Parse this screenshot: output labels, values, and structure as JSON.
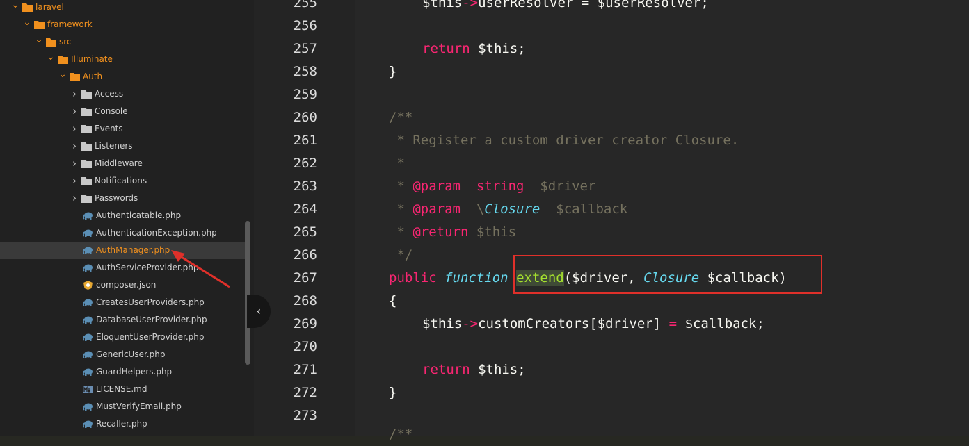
{
  "sidebar": {
    "tree": [
      {
        "label": "laravel",
        "kind": "folder",
        "open": true
      },
      {
        "label": "framework",
        "kind": "folder",
        "open": true
      },
      {
        "label": "src",
        "kind": "folder",
        "open": true
      },
      {
        "label": "Illuminate",
        "kind": "folder",
        "open": true
      },
      {
        "label": "Auth",
        "kind": "folder",
        "open": true
      },
      {
        "label": "Access",
        "kind": "folder",
        "open": false
      },
      {
        "label": "Console",
        "kind": "folder",
        "open": false
      },
      {
        "label": "Events",
        "kind": "folder",
        "open": false
      },
      {
        "label": "Listeners",
        "kind": "folder",
        "open": false
      },
      {
        "label": "Middleware",
        "kind": "folder",
        "open": false
      },
      {
        "label": "Notifications",
        "kind": "folder",
        "open": false
      },
      {
        "label": "Passwords",
        "kind": "folder",
        "open": false
      },
      {
        "label": "Authenticatable.php",
        "kind": "php"
      },
      {
        "label": "AuthenticationException.php",
        "kind": "php"
      },
      {
        "label": "AuthManager.php",
        "kind": "php",
        "selected": true
      },
      {
        "label": "AuthServiceProvider.php",
        "kind": "php"
      },
      {
        "label": "composer.json",
        "kind": "json"
      },
      {
        "label": "CreatesUserProviders.php",
        "kind": "php"
      },
      {
        "label": "DatabaseUserProvider.php",
        "kind": "php"
      },
      {
        "label": "EloquentUserProvider.php",
        "kind": "php"
      },
      {
        "label": "GenericUser.php",
        "kind": "php"
      },
      {
        "label": "GuardHelpers.php",
        "kind": "php"
      },
      {
        "label": "LICENSE.md",
        "kind": "md"
      },
      {
        "label": "MustVerifyEmail.php",
        "kind": "php"
      },
      {
        "label": "Recaller.php",
        "kind": "php"
      }
    ]
  },
  "editor": {
    "line_numbers": [
      "255",
      "256",
      "257",
      "258",
      "259",
      "260",
      "261",
      "262",
      "263",
      "264",
      "265",
      "266",
      "267",
      "268",
      "269",
      "270",
      "271",
      "272",
      "273"
    ],
    "code": {
      "l255_this": "$this",
      "l255_arrow": "->",
      "l255_rest": "userResolver = $userResolver;",
      "l257_kw": "return",
      "l257_rest": " $this;",
      "l258": "}",
      "l260": "/**",
      "l261": " * Register a custom driver creator Closure.",
      "l262": " *",
      "l263_star": " * ",
      "l263_tag": "@param",
      "l263_type": "  string",
      "l263_var": "  $driver",
      "l264_star": " * ",
      "l264_tag": "@param",
      "l264_slash": "  \\",
      "l264_type": "Closure",
      "l264_var": "  $callback",
      "l265_star": " * ",
      "l265_tag": "@return",
      "l265_var": " $this",
      "l266": " */",
      "l267_kw": "public",
      "l267_fn": "function",
      "l267_name": "extend",
      "l267_open": "($driver, ",
      "l267_type": "Closure",
      "l267_close": " $callback)",
      "l268": "{",
      "l269_this": "$this",
      "l269_arrow": "->",
      "l269_mid": "customCreators[$driver] ",
      "l269_eq": "=",
      "l269_rest": " $callback;",
      "l271_kw": "return",
      "l271_rest": " $this;",
      "l272": "}",
      "l274": "/**"
    }
  },
  "colors": {
    "accent_orange": "#f0901e",
    "keyword_pink": "#f92672",
    "type_cyan": "#66d9ef",
    "comment_gray": "#75715e",
    "annotation_red": "#e0302a"
  }
}
